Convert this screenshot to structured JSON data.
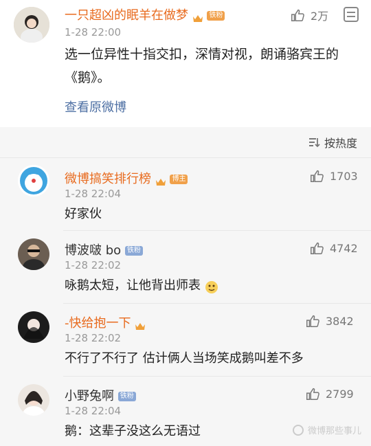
{
  "post": {
    "author": "一只超凶的眠羊在做梦",
    "badge": "铁粉",
    "time": "1-28 22:00",
    "likes": "2万",
    "content": "选一位异性十指交扣，深情对视，朗诵骆宾王的《鹅》。",
    "link": "查看原微博"
  },
  "comments_header": {
    "sort_label": "按热度"
  },
  "comments": [
    {
      "author": "微博搞笑排行榜",
      "badge": "博主",
      "time": "1-28 22:04",
      "likes": "1703",
      "text": "好家伙"
    },
    {
      "author": "博波啵 bo",
      "badge": "铁粉",
      "time": "1-28 22:02",
      "likes": "4742",
      "text": "咏鹅太短，让他背出师表"
    },
    {
      "author": "-快给抱一下",
      "badge": "",
      "time": "1-28 22:02",
      "likes": "3842",
      "text": "不行了不行了 估计俩人当场笑成鹅叫差不多"
    },
    {
      "author": "小野兔啊",
      "badge": "铁粉",
      "time": "1-28 22:04",
      "likes": "2799",
      "text": "鹅：这辈子没这么无语过"
    }
  ],
  "watermark": "微博那些事儿",
  "colors": {
    "accent": "#e86b1f",
    "link": "#4d6fa3",
    "muted": "#999999",
    "bg": "#f6f6f6"
  },
  "icons": {
    "like": "thumbs-up-icon",
    "sort": "sort-icon",
    "crown": "crown-icon",
    "more": "menu-icon"
  }
}
